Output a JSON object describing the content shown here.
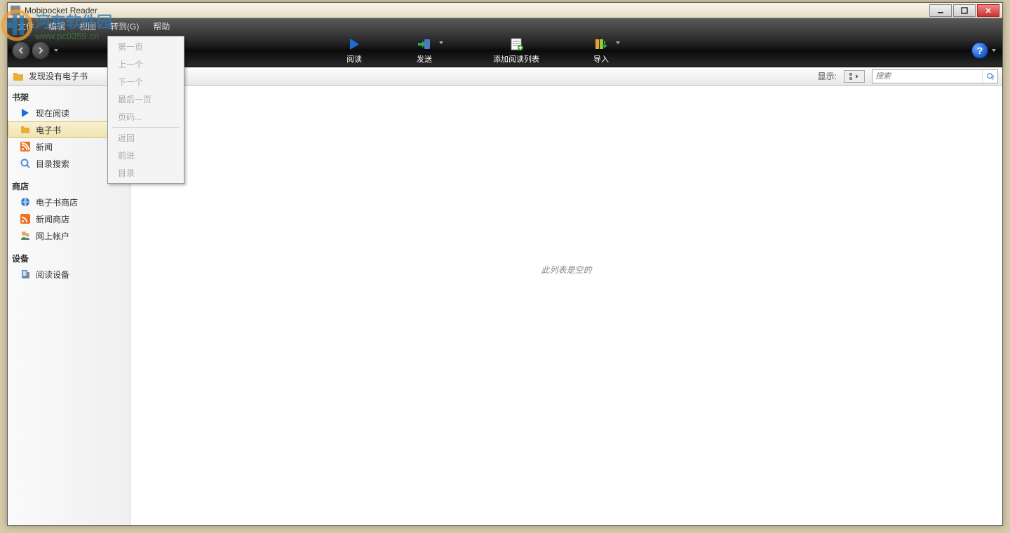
{
  "window": {
    "title": "Mobipocket Reader"
  },
  "menubar": {
    "items": [
      "文件",
      "编辑",
      "视图",
      "转到(G)",
      "帮助"
    ]
  },
  "toolbar": {
    "buttons": [
      {
        "label": "阅读",
        "icon": "play"
      },
      {
        "label": "发送",
        "icon": "send"
      },
      {
        "label": "添加阅读列表",
        "icon": "add-list"
      },
      {
        "label": "导入",
        "icon": "import"
      }
    ]
  },
  "locbar": {
    "text": "发现没有电子书",
    "view_label": "显示:",
    "search_placeholder": "搜索"
  },
  "sidebar": {
    "groups": [
      {
        "header": "书架",
        "items": [
          {
            "label": "现在阅读",
            "icon": "play"
          },
          {
            "label": "电子书",
            "icon": "folder",
            "selected": true
          },
          {
            "label": "新闻",
            "icon": "rss"
          },
          {
            "label": "目录搜索",
            "icon": "search"
          }
        ]
      },
      {
        "header": "商店",
        "items": [
          {
            "label": "电子书商店",
            "icon": "globe"
          },
          {
            "label": "新闻商店",
            "icon": "rss-store"
          },
          {
            "label": "网上帐户",
            "icon": "account"
          }
        ]
      },
      {
        "header": "设备",
        "items": [
          {
            "label": "阅读设备",
            "icon": "device"
          }
        ]
      }
    ]
  },
  "dropdown": {
    "groups": [
      [
        "第一页",
        "上一个",
        "下一个",
        "最后一页",
        "页码..."
      ],
      [
        "返回",
        "前进",
        "目录"
      ]
    ]
  },
  "content": {
    "empty": "此列表是空的"
  },
  "watermark": {
    "main": "河东软件园",
    "sub": "www.pc0359.cn"
  }
}
